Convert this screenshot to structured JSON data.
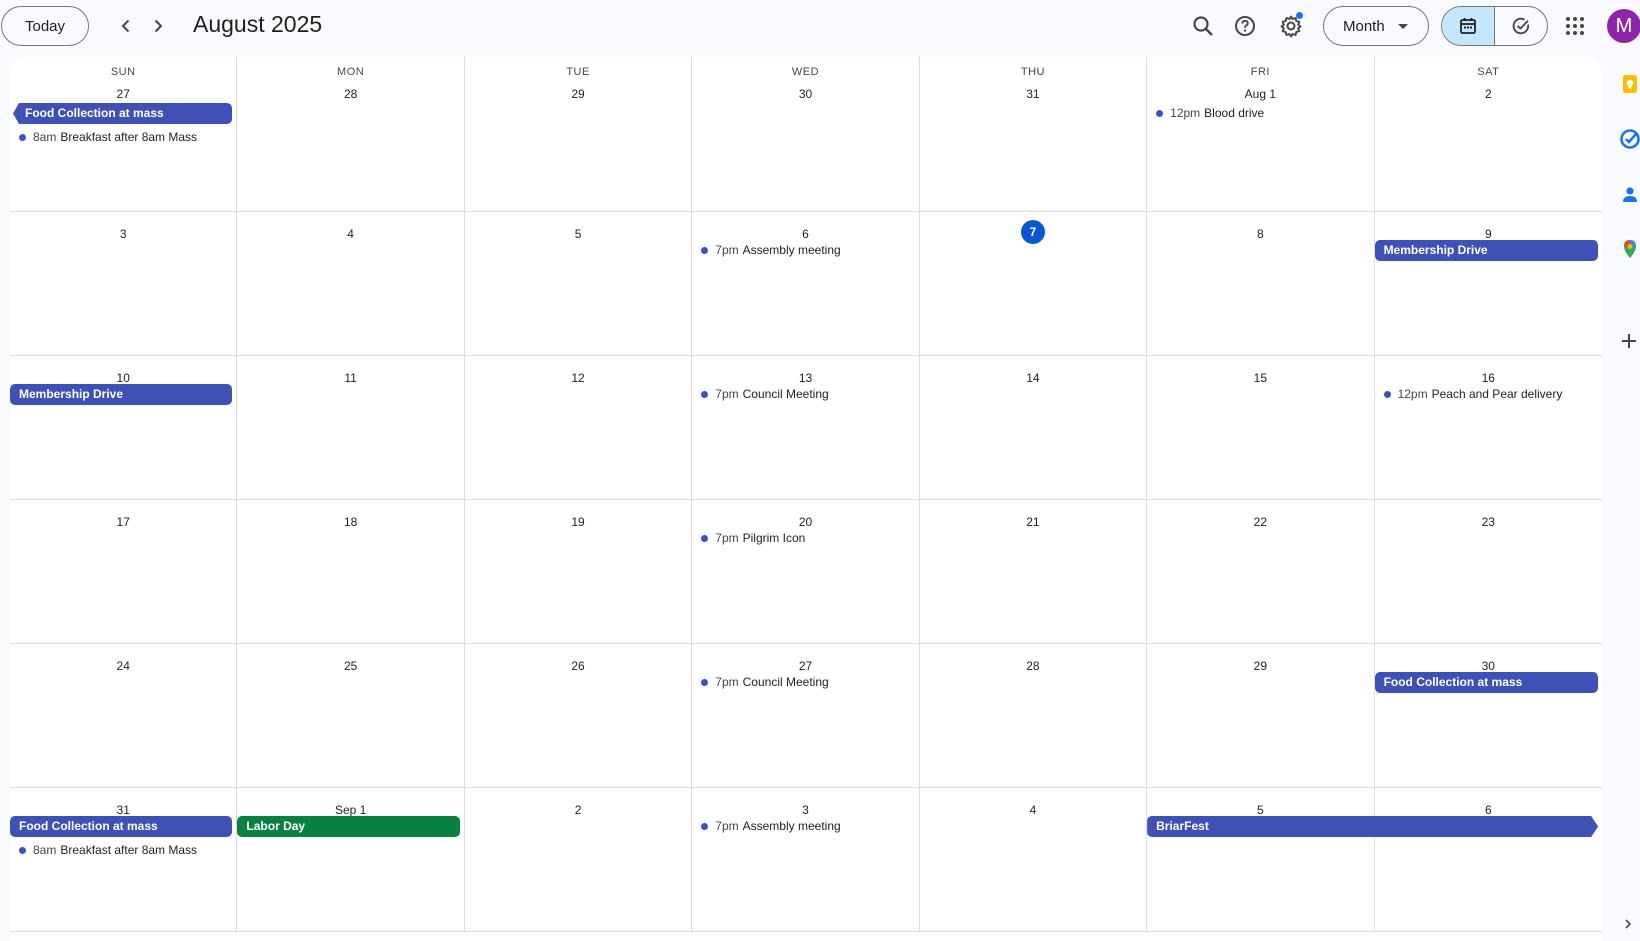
{
  "header": {
    "today_label": "Today",
    "title": "August 2025",
    "view_select": "Month",
    "avatar_initial": "M"
  },
  "colors": {
    "event_blue": "#3f51b5",
    "event_green": "#0b8043",
    "today": "#0b57d0"
  },
  "calendar": {
    "weekdays": [
      "SUN",
      "MON",
      "TUE",
      "WED",
      "THU",
      "FRI",
      "SAT"
    ],
    "weeks": [
      [
        {
          "day": "27",
          "events": [
            {
              "kind": "bar",
              "title": "Food Collection at mass",
              "color": "blue",
              "continues_from_prev": true
            },
            {
              "kind": "dot",
              "time": "8am",
              "title": "Breakfast after 8am Mass"
            }
          ]
        },
        {
          "day": "28",
          "events": []
        },
        {
          "day": "29",
          "events": []
        },
        {
          "day": "30",
          "events": []
        },
        {
          "day": "31",
          "events": []
        },
        {
          "day": "Aug 1",
          "events": [
            {
              "kind": "dot",
              "time": "12pm",
              "title": "Blood drive"
            }
          ]
        },
        {
          "day": "2",
          "events": []
        }
      ],
      [
        {
          "day": "3",
          "events": []
        },
        {
          "day": "4",
          "events": []
        },
        {
          "day": "5",
          "events": []
        },
        {
          "day": "6",
          "events": [
            {
              "kind": "dot",
              "time": "7pm",
              "title": "Assembly meeting"
            }
          ]
        },
        {
          "day": "7",
          "today": true,
          "events": []
        },
        {
          "day": "8",
          "events": []
        },
        {
          "day": "9",
          "events": [
            {
              "kind": "bar",
              "title": "Membership Drive",
              "color": "blue"
            }
          ]
        }
      ],
      [
        {
          "day": "10",
          "events": [
            {
              "kind": "bar",
              "title": "Membership Drive",
              "color": "blue"
            }
          ]
        },
        {
          "day": "11",
          "events": []
        },
        {
          "day": "12",
          "events": []
        },
        {
          "day": "13",
          "events": [
            {
              "kind": "dot",
              "time": "7pm",
              "title": "Council Meeting"
            }
          ]
        },
        {
          "day": "14",
          "events": []
        },
        {
          "day": "15",
          "events": []
        },
        {
          "day": "16",
          "events": [
            {
              "kind": "dot",
              "time": "12pm",
              "title": "Peach and Pear delivery"
            }
          ]
        }
      ],
      [
        {
          "day": "17",
          "events": []
        },
        {
          "day": "18",
          "events": []
        },
        {
          "day": "19",
          "events": []
        },
        {
          "day": "20",
          "events": [
            {
              "kind": "dot",
              "time": "7pm",
              "title": "Pilgrim Icon"
            }
          ]
        },
        {
          "day": "21",
          "events": []
        },
        {
          "day": "22",
          "events": []
        },
        {
          "day": "23",
          "events": []
        }
      ],
      [
        {
          "day": "24",
          "events": []
        },
        {
          "day": "25",
          "events": []
        },
        {
          "day": "26",
          "events": []
        },
        {
          "day": "27",
          "events": [
            {
              "kind": "dot",
              "time": "7pm",
              "title": "Council Meeting"
            }
          ]
        },
        {
          "day": "28",
          "events": []
        },
        {
          "day": "29",
          "events": []
        },
        {
          "day": "30",
          "events": [
            {
              "kind": "bar",
              "title": "Food Collection at mass",
              "color": "blue"
            }
          ]
        }
      ],
      [
        {
          "day": "31",
          "events": [
            {
              "kind": "bar",
              "title": "Food Collection at mass",
              "color": "blue"
            },
            {
              "kind": "dot",
              "time": "8am",
              "title": "Breakfast after 8am Mass"
            }
          ]
        },
        {
          "day": "Sep 1",
          "events": [
            {
              "kind": "bar",
              "title": "Labor Day",
              "color": "green"
            }
          ]
        },
        {
          "day": "2",
          "events": []
        },
        {
          "day": "3",
          "events": [
            {
              "kind": "dot",
              "time": "7pm",
              "title": "Assembly meeting"
            }
          ]
        },
        {
          "day": "4",
          "events": []
        },
        {
          "day": "5",
          "events": [
            {
              "kind": "bar",
              "title": "BriarFest",
              "color": "blue",
              "span": 2,
              "continues_to_next": true
            }
          ]
        },
        {
          "day": "6",
          "events": []
        }
      ]
    ]
  },
  "side_panel": {
    "icons": [
      "keep-icon",
      "tasks-icon",
      "contacts-icon",
      "maps-icon"
    ]
  }
}
